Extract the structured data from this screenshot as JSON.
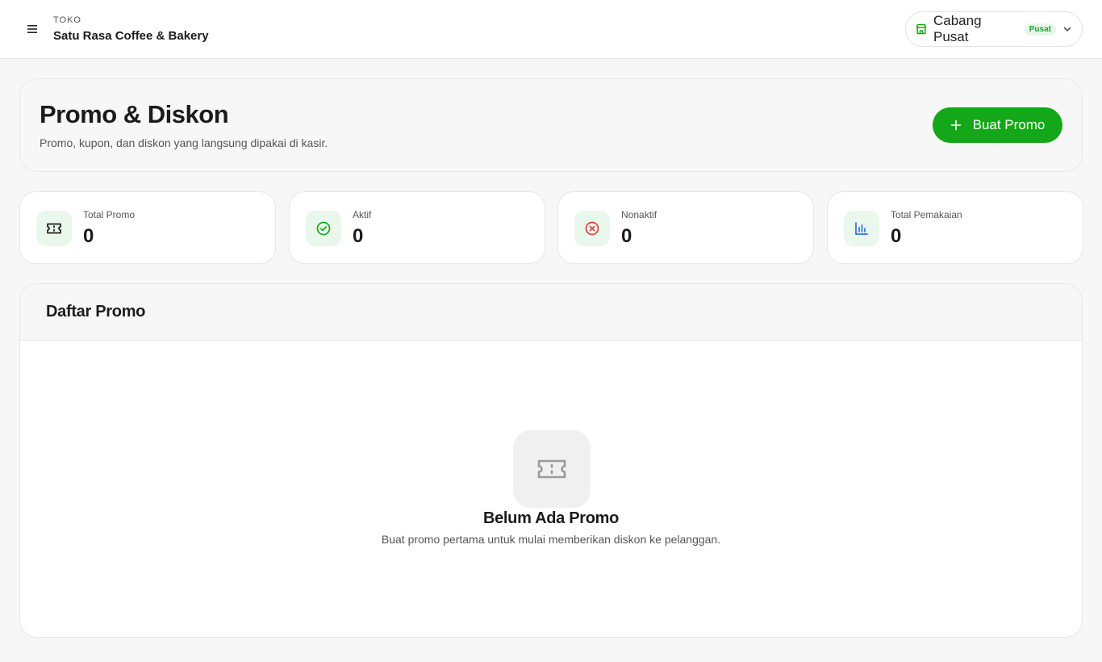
{
  "header": {
    "store_caption": "TOKO",
    "store_name": "Satu Rasa Coffee & Bakery",
    "menu_icon": "hamburger-icon",
    "branch": {
      "icon": "store-icon",
      "name": "Cabang Pusat",
      "badge": "Pusat",
      "chevron": "chevron-down-icon"
    }
  },
  "page": {
    "title": "Promo & Diskon",
    "subtitle": "Promo, kupon, dan diskon yang langsung dipakai di kasir.",
    "create_button": {
      "icon": "plus-icon",
      "label": "Buat Promo"
    }
  },
  "stats": [
    {
      "label": "Total Promo",
      "value": "0",
      "icon": "ticket-icon",
      "icon_color": "#1b1b1b"
    },
    {
      "label": "Aktif",
      "value": "0",
      "icon": "check-circle-icon",
      "icon_color": "#13a819"
    },
    {
      "label": "Nonaktif",
      "value": "0",
      "icon": "x-circle-icon",
      "icon_color": "#d9433a"
    },
    {
      "label": "Total Pemakaian",
      "value": "0",
      "icon": "bar-chart-icon",
      "icon_color": "#2f6fe0"
    }
  ],
  "list": {
    "title": "Daftar Promo",
    "empty_state": {
      "icon": "ticket-icon",
      "title": "Belum Ada Promo",
      "text": "Buat promo pertama untuk mulai memberikan diskon ke pelanggan."
    }
  },
  "colors": {
    "accent": "#13a819",
    "accent_soft": "#e9f7ec",
    "danger": "#d9433a",
    "info": "#2f6fe0"
  }
}
